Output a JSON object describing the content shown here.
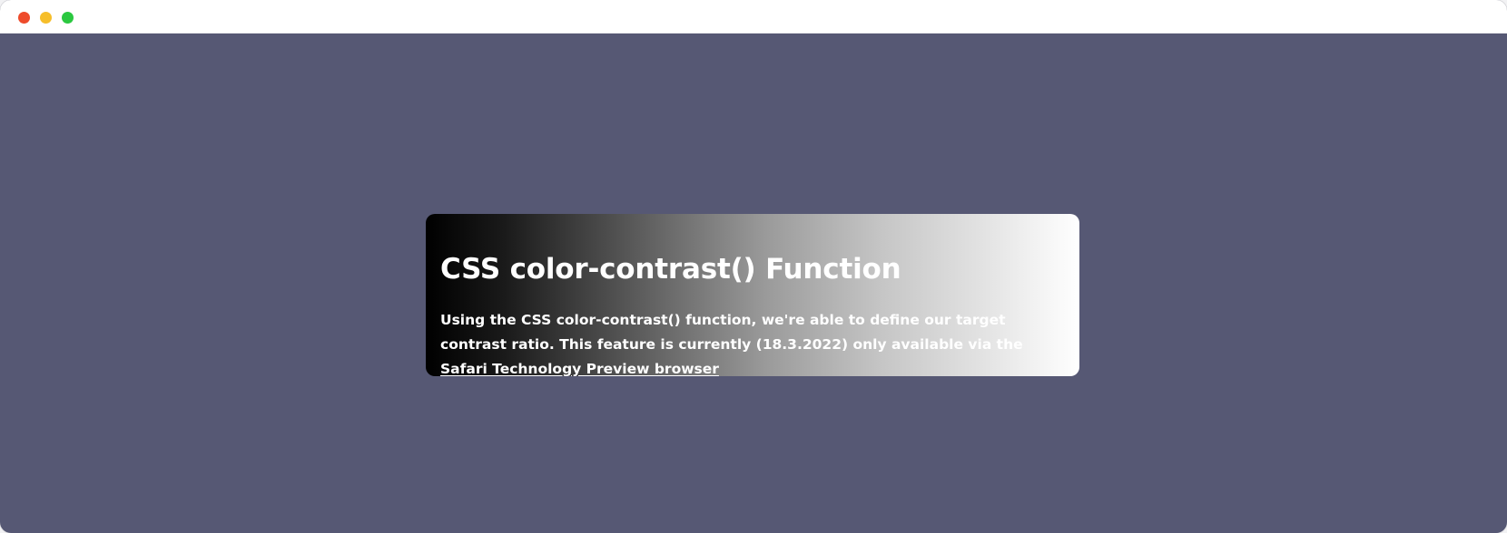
{
  "window": {
    "controls": [
      {
        "name": "close",
        "color": "#ee4b2b"
      },
      {
        "name": "minimize",
        "color": "#f6be2a"
      },
      {
        "name": "maximize",
        "color": "#2bc840"
      }
    ],
    "background_color": "#565874"
  },
  "card": {
    "title": "CSS color-contrast() Function",
    "body_text": "Using the CSS color-contrast() function, we're able to define our target contrast ratio. This feature is currently (18.3.2022) only available via the",
    "link_text": "Safari Technology Preview browser",
    "gradient": [
      "#000000",
      "#ffffff"
    ],
    "text_color": "#ffffff"
  }
}
